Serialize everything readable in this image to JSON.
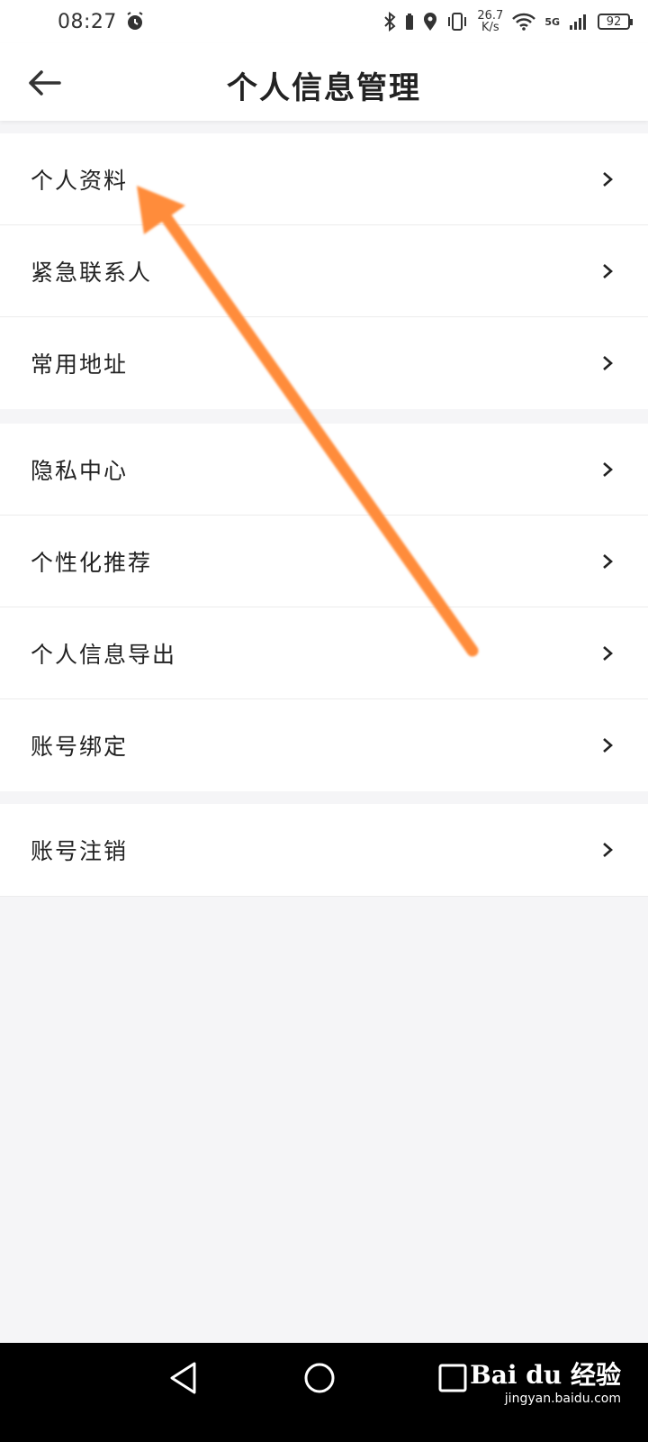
{
  "status_bar": {
    "time": "08:27",
    "net_speed_value": "26.7",
    "net_speed_unit": "K/s",
    "network_type": "5G",
    "battery": "92",
    "icons": [
      "alarm-icon",
      "bluetooth-icon",
      "battery-small-icon",
      "location-icon",
      "vibrate-icon",
      "wifi-icon",
      "signal-icon",
      "battery-icon"
    ]
  },
  "header": {
    "title": "个人信息管理",
    "back_icon": "back-arrow-icon"
  },
  "groups": [
    {
      "items": [
        {
          "label": "个人资料"
        },
        {
          "label": "紧急联系人"
        },
        {
          "label": "常用地址"
        }
      ]
    },
    {
      "items": [
        {
          "label": "隐私中心"
        },
        {
          "label": "个性化推荐"
        },
        {
          "label": "个人信息导出"
        },
        {
          "label": "账号绑定"
        }
      ]
    },
    {
      "items": [
        {
          "label": "账号注销"
        }
      ]
    }
  ],
  "annotation": {
    "color": "#ff8c3a",
    "points_to": "个人资料"
  },
  "nav_bar": {
    "buttons": [
      "back-triangle-icon",
      "home-circle-icon",
      "recents-square-icon"
    ]
  },
  "watermark": {
    "brand": "Bai du 经验",
    "url": "jingyan.baidu.com"
  },
  "colors": {
    "background": "#f5f5f7",
    "card": "#ffffff",
    "divider": "#ececec",
    "text": "#222222",
    "nav": "#000000"
  }
}
